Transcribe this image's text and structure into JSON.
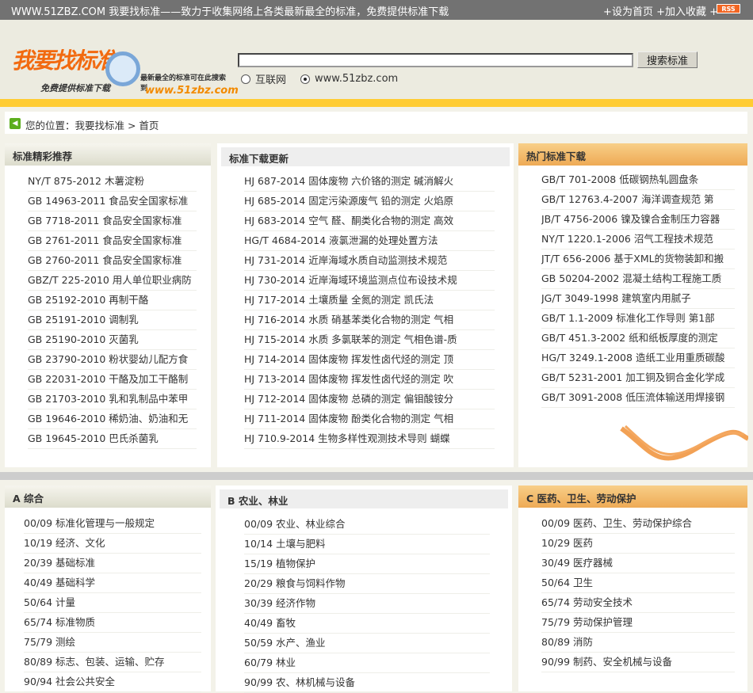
{
  "topbar": {
    "title": "WWW.51ZBZ.COM 我要找标准——致力于收集网络上各类最新最全的标准，免费提供标准下载",
    "links": "+设为首页 +加入收藏 +",
    "rss": "RSS"
  },
  "logo": {
    "name": "我要找标准",
    "sub": "免费提供标准下载",
    "slogan": "最新最全的标准可在此搜索到",
    "url": "www.51zbz.com"
  },
  "search": {
    "value": "",
    "button": "搜索标准",
    "options": [
      "互联网",
      "www.51zbz.com"
    ],
    "selected": 1
  },
  "breadcrumb": "您的位置：我要找标准 > 首页",
  "colors": {
    "accent": "#ffcc33",
    "bullet": "#f08020",
    "topbar": "#727272"
  },
  "sections": [
    {
      "title": "标准精彩推荐",
      "items": [
        "NY/T 875-2012 木薯淀粉",
        "GB 14963-2011 食品安全国家标准",
        "GB 7718-2011 食品安全国家标准",
        "GB 2761-2011 食品安全国家标准",
        "GB 2760-2011 食品安全国家标准",
        "GBZ/T 225-2010 用人单位职业病防",
        "GB 25192-2010 再制干酪",
        "GB 25191-2010 调制乳",
        "GB 25190-2010 灭菌乳",
        "GB 23790-2010 粉状婴幼儿配方食",
        "GB 22031-2010 干酪及加工干酪制",
        "GB 21703-2010 乳和乳制品中苯甲",
        "GB 19646-2010 稀奶油、奶油和无",
        "GB 19645-2010 巴氏杀菌乳"
      ]
    },
    {
      "title": "标准下载更新",
      "items": [
        "HJ 687-2014 固体废物 六价铬的测定 碱消解火",
        "HJ 685-2014 固定污染源废气 铅的测定 火焰原",
        "HJ 683-2014 空气 醛、酮类化合物的测定 高效",
        "HG/T 4684-2014 液氯泄漏的处理处置方法",
        "HJ 731-2014 近岸海域水质自动监测技术规范",
        "HJ 730-2014 近岸海域环境监测点位布设技术规",
        "HJ 717-2014 土壤质量 全氮的测定 凯氏法",
        "HJ 716-2014 水质 硝基苯类化合物的测定 气相",
        "HJ 715-2014 水质 多氯联苯的测定 气相色谱-质",
        "HJ 714-2014 固体废物 挥发性卤代烃的测定 顶",
        "HJ 713-2014 固体废物 挥发性卤代烃的测定 吹",
        "HJ 712-2014 固体废物 总磷的测定 偏钼酸铵分",
        "HJ 711-2014 固体废物 酚类化合物的测定 气相",
        "HJ 710.9-2014 生物多样性观测技术导则 蝴蝶"
      ]
    },
    {
      "title": "热门标准下载",
      "items": [
        "GB/T 701-2008 低碳钢热轧圆盘条",
        "GB/T 12763.4-2007 海洋调查规范 第",
        "JB/T 4756-2006 镍及镍合金制压力容器",
        "NY/T 1220.1-2006 沼气工程技术规范",
        "JT/T 656-2006 基于XML的货物装卸和搬",
        "GB 50204-2002 混凝土结构工程施工质",
        "JG/T 3049-1998 建筑室内用腻子",
        "GB/T 1.1-2009 标准化工作导则 第1部",
        "GB/T 451.3-2002 纸和纸板厚度的测定",
        "HG/T 3249.1-2008 造纸工业用重质碳酸",
        "GB/T 5231-2001 加工铜及铜合金化学成",
        "GB/T 3091-2008 低压流体输送用焊接钢"
      ]
    },
    {
      "title": "A 综合",
      "items": [
        "00/09 标准化管理与一般规定",
        "10/19 经济、文化",
        "20/39 基础标准",
        "40/49 基础科学",
        "50/64 计量",
        "65/74 标准物质",
        "75/79 测绘",
        "80/89 标志、包装、运输、贮存",
        "90/94 社会公共安全"
      ]
    },
    {
      "title": "B 农业、林业",
      "items": [
        "00/09 农业、林业综合",
        "10/14 土壤与肥料",
        "15/19 植物保护",
        "20/29 粮食与饲料作物",
        "30/39 经济作物",
        "40/49 畜牧",
        "50/59 水产、渔业",
        "60/79 林业",
        "90/99 农、林机械与设备"
      ]
    },
    {
      "title": "C 医药、卫生、劳动保护",
      "items": [
        "00/09 医药、卫生、劳动保护综合",
        "10/29 医药",
        "30/49 医疗器械",
        "50/64 卫生",
        "65/74 劳动安全技术",
        "75/79 劳动保护管理",
        "80/89 消防",
        "90/99 制药、安全机械与设备"
      ]
    }
  ]
}
